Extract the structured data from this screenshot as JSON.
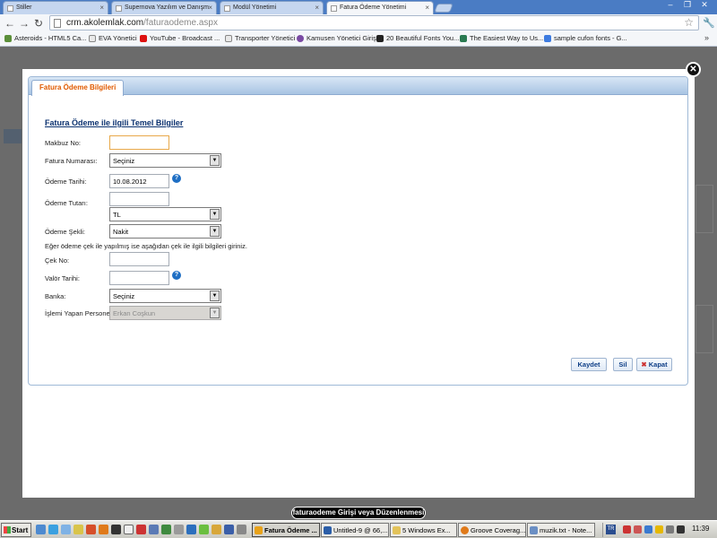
{
  "browser": {
    "tabs": [
      {
        "label": "Stiller"
      },
      {
        "label": "Supernova Yazılım ve Danışm"
      },
      {
        "label": "Modül Yönetimi"
      },
      {
        "label": "Fatura Ödeme Yönetimi"
      }
    ],
    "url_host": "crm.akolemlak.com",
    "url_path": "/faturaodeme.aspx",
    "bookmarks": [
      {
        "label": "Asteroids - HTML5 Ca...",
        "color": "#5b8f3a"
      },
      {
        "label": "EVA Yönetici",
        "color": "#e9e9e9"
      },
      {
        "label": "YouTube - Broadcast ...",
        "color": "#d11"
      },
      {
        "label": "Transporter Yönetici",
        "color": "#e9e9e9"
      },
      {
        "label": "Kamusen Yönetici Girişi",
        "color": "#7a4aa3"
      },
      {
        "label": "20 Beautiful Fonts You...",
        "color": "#222"
      },
      {
        "label": "The Easiest Way to Us...",
        "color": "#2a7a52"
      },
      {
        "label": "sample cufon fonts - G...",
        "color": "#3d7be0"
      }
    ]
  },
  "modal": {
    "tab_label": "Fatura Ödeme Bilgileri",
    "section_title": "Fatura Ödeme ile ilgili Temel Bilgiler",
    "fields": {
      "makbuz_no": {
        "label": "Makbuz No:",
        "value": ""
      },
      "fatura_numarasi": {
        "label": "Fatura Numarası:",
        "value": "Seçiniz"
      },
      "odeme_tarihi": {
        "label": "Ödeme Tarihi:",
        "value": "10.08.2012"
      },
      "odeme_tutari": {
        "label": "Ödeme Tutarı:",
        "value": "",
        "currency": "TL"
      },
      "odeme_sekli": {
        "label": "Ödeme Şekli:",
        "value": "Nakit"
      },
      "cek_no": {
        "label": "Çek No:",
        "value": ""
      },
      "valor_tarihi": {
        "label": "Valör Tarihi:",
        "value": ""
      },
      "banka": {
        "label": "Banka:",
        "value": "Seçiniz"
      },
      "islemi_yapan": {
        "label": "İşlemi Yapan Personel:",
        "value": "Erkan Coşkun"
      }
    },
    "cheque_note": "Eğer ödeme çek ile yapılmış ise aşağıdan çek ile ilgili bilgileri giriniz.",
    "buttons": {
      "save": "Kaydet",
      "delete": "Sil",
      "close": "Kapat"
    },
    "help_glyph": "?",
    "close_glyph": "✕"
  },
  "caption": "faturaodeme Girişi veya Düzenlenmesi",
  "taskbar": {
    "start_label": "Start",
    "tasks": [
      {
        "label": "Fatura Ödeme ...",
        "color": "#e8a21a"
      },
      {
        "label": "Untitled-9 @ 66,...",
        "color": "#2b5ea8"
      },
      {
        "label": "5 Windows Ex...",
        "color": "#e3c35a"
      },
      {
        "label": "Groove Coverag...",
        "color": "#e07a1a"
      },
      {
        "label": "muzik.txt - Note...",
        "color": "#6b8fc4"
      }
    ],
    "lang": "TR",
    "clock": "11:39"
  }
}
